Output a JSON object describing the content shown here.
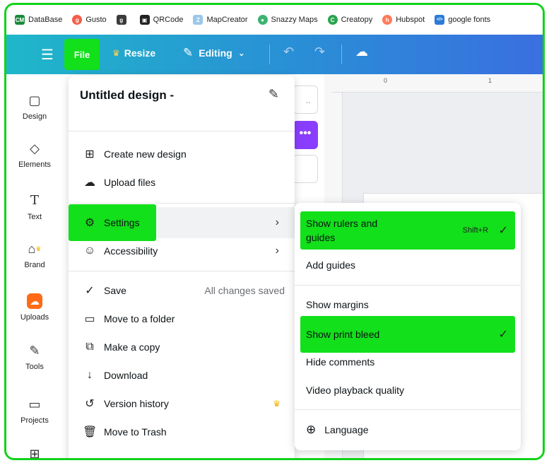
{
  "bookmarks": [
    {
      "label": "DataBase",
      "icon": "cm-icon",
      "icon_text": "CM",
      "color": "#1a8a3a"
    },
    {
      "label": "Gusto",
      "icon": "gusto-icon",
      "icon_text": "g",
      "color": "#f45d48"
    },
    {
      "label": "",
      "icon": "g-icon",
      "icon_text": "g",
      "color": "#3a3a3a"
    },
    {
      "label": "QRCode",
      "icon": "qr-icon",
      "icon_text": "▣",
      "color": "#222222"
    },
    {
      "label": "MapCreator",
      "icon": "map-creator-icon",
      "icon_text": "Z",
      "color": "#9cc8e8"
    },
    {
      "label": "Snazzy Maps",
      "icon": "snazzy-icon",
      "icon_text": "●",
      "color": "#3cb371"
    },
    {
      "label": "Creatopy",
      "icon": "creatopy-icon",
      "icon_text": "C",
      "color": "#2ca44f"
    },
    {
      "label": "Hubspot",
      "icon": "hubspot-icon",
      "icon_text": "h",
      "color": "#ff7a59"
    },
    {
      "label": "google fonts",
      "icon": "code-icon",
      "icon_text": "</>",
      "color": "#2b7bd8"
    }
  ],
  "toolbar": {
    "file_label": "File",
    "resize_label": "Resize",
    "editing_label": "Editing"
  },
  "rail": [
    {
      "label": "Design",
      "icon": "design-icon",
      "glyph": "▢"
    },
    {
      "label": "Elements",
      "icon": "elements-icon",
      "glyph": "◇"
    },
    {
      "label": "Text",
      "icon": "text-icon",
      "glyph": "T"
    },
    {
      "label": "Brand",
      "icon": "brand-icon",
      "glyph": "⌂"
    },
    {
      "label": "Uploads",
      "icon": "uploads-icon",
      "glyph": "☁"
    },
    {
      "label": "Tools",
      "icon": "tools-icon",
      "glyph": "✎"
    },
    {
      "label": "Projects",
      "icon": "projects-icon",
      "glyph": "▭"
    },
    {
      "label": "",
      "icon": "apps-icon",
      "glyph": "⊞"
    }
  ],
  "ruler": {
    "tick_0": "0",
    "tick_1": "1"
  },
  "file_menu": {
    "title": "Untitled design -",
    "items": [
      {
        "label": "Create new design",
        "icon": "create-new-icon",
        "glyph": "⊞"
      },
      {
        "label": "Upload files",
        "icon": "upload-cloud-icon",
        "glyph": "☁"
      },
      {
        "label": "Settings",
        "icon": "settings-gear-icon",
        "glyph": "⚙"
      },
      {
        "label": "Accessibility",
        "icon": "accessibility-icon",
        "glyph": "☺"
      },
      {
        "label": "Save",
        "icon": "save-check-icon",
        "glyph": "✓",
        "aside": "All changes saved"
      },
      {
        "label": "Move to a folder",
        "icon": "folder-icon",
        "glyph": "▭"
      },
      {
        "label": "Make a copy",
        "icon": "copy-icon",
        "glyph": "⧉"
      },
      {
        "label": "Download",
        "icon": "download-icon",
        "glyph": "↓"
      },
      {
        "label": "Version history",
        "icon": "history-icon",
        "glyph": "↺"
      },
      {
        "label": "Move to Trash",
        "icon": "trash-icon",
        "glyph": "🗑"
      }
    ]
  },
  "sub_menu": {
    "items": [
      {
        "label_line1": "Show rulers and",
        "label_line2": "guides",
        "shortcut": "Shift+R",
        "checked": true
      },
      {
        "label": "Add guides"
      },
      {
        "label": "Show margins"
      },
      {
        "label": "Show print bleed",
        "checked": true
      },
      {
        "label": "Hide comments"
      },
      {
        "label": "Video playback quality"
      },
      {
        "label": "Language"
      }
    ]
  },
  "colors": {
    "highlight": "#12e01a",
    "toolbar_start": "#1fb7c9",
    "toolbar_end": "#3a6fe0",
    "accent_purple": "#8b3dff"
  }
}
